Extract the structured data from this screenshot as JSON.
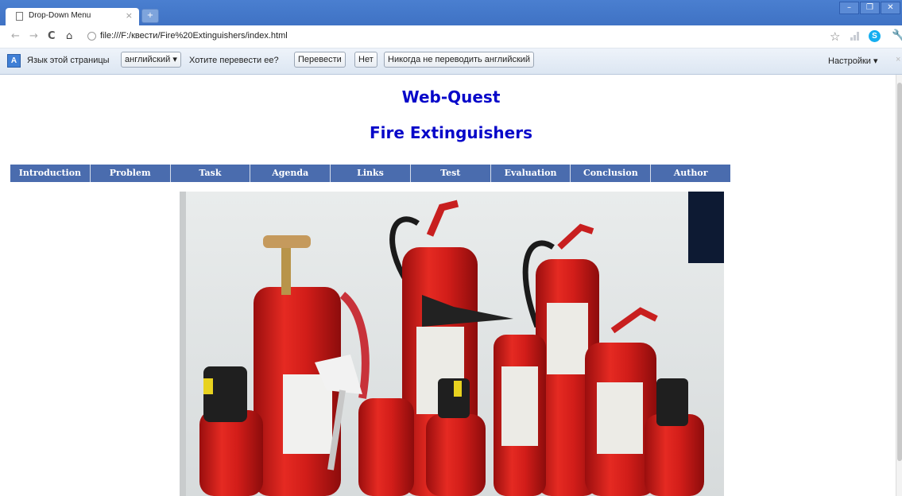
{
  "browser": {
    "tab_title": "Drop-Down Menu",
    "tab_close": "×",
    "new_tab": "+",
    "window_controls": [
      "–",
      "❐",
      "✕"
    ],
    "url": "file:///F:/квести/Fire%20Extinguishers/index.html",
    "icons": [
      "back-icon",
      "forward-icon",
      "reload-icon",
      "home-icon",
      "star-icon",
      "signal-icon",
      "skype-icon",
      "wrench-icon"
    ]
  },
  "translate_bar": {
    "icon_label": "A",
    "language_prompt": "Язык этой страницы",
    "language_value": "английский ▾",
    "question": "Хотите перевести ее?",
    "translate_button": "Перевести",
    "no_button": "Нет",
    "never_button": "Никогда не переводить английский",
    "settings": "Настройки ▾",
    "close": "×"
  },
  "page": {
    "heading": "Web-Quest",
    "subheading": "Fire Extinguishers",
    "menu": [
      "Introduction",
      "Problem",
      "Task",
      "Agenda",
      "Links",
      "Test",
      "Evaluation",
      "Conclusion",
      "Author"
    ]
  },
  "colors": {
    "heading": "#0707c9",
    "menu_bg": "#4a6cae",
    "titlebar": "#3f72c4",
    "extinguisher_red": "#d81e1e"
  }
}
